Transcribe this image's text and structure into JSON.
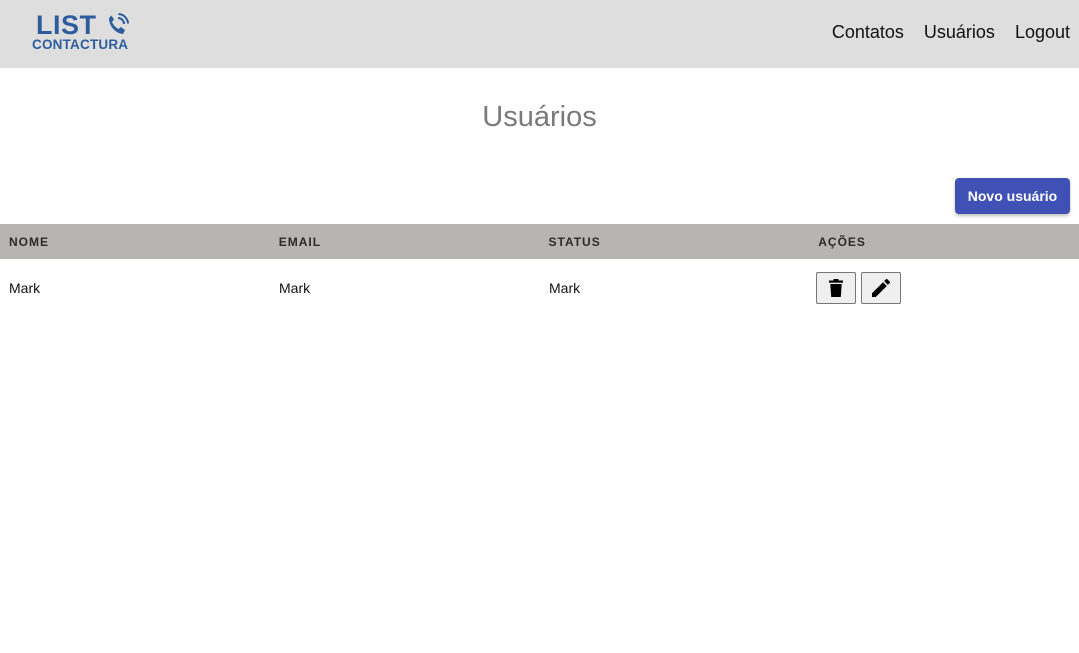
{
  "header": {
    "logo": {
      "title": "LIST",
      "subtitle": "CONTACTURA",
      "icon": "phone-ringing-icon",
      "color": "#2e5d9e"
    },
    "nav": [
      {
        "label": "Contatos"
      },
      {
        "label": "Usuários"
      },
      {
        "label": "Logout"
      }
    ]
  },
  "main": {
    "title": "Usuários",
    "new_button_label": "Novo usuário",
    "accent_color": "#3f51b5",
    "table": {
      "columns": [
        "NOME",
        "EMAIL",
        "STATUS",
        "AÇÕES"
      ],
      "rows": [
        {
          "nome": "Mark",
          "email": "Mark",
          "status": "Mark",
          "actions": [
            "trash-icon",
            "pencil-icon"
          ]
        }
      ]
    }
  }
}
